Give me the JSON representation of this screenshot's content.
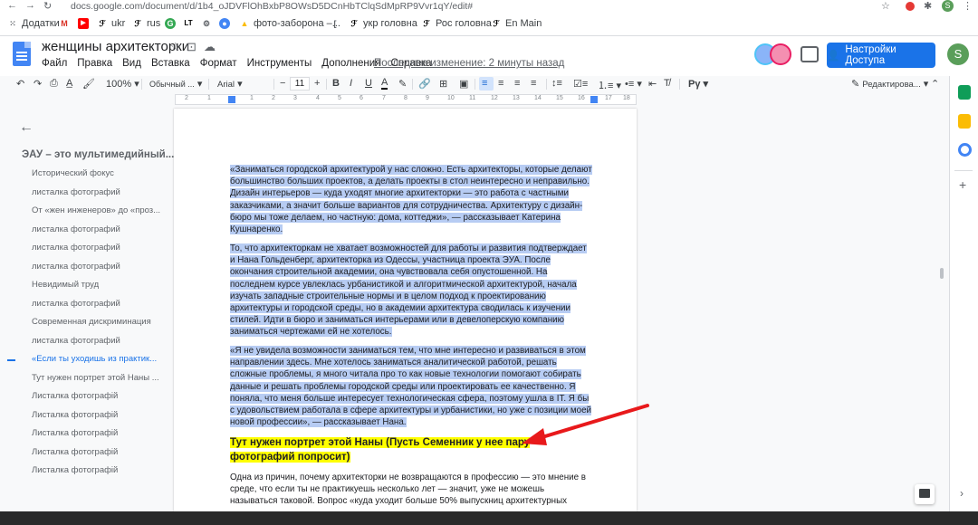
{
  "browser": {
    "url": "docs.google.com/document/d/1b4_oJDVFlOhBxbP8OWsD5DCnHbTClqSdMpRP9Vvr1qY/edit#",
    "bookmarks": [
      "Додатки",
      "ukr",
      "rus",
      "фото-заборона –...",
      "укр головна",
      "Рос головна",
      "En Main"
    ]
  },
  "doc": {
    "title": "женщины архитекторки",
    "menus": [
      "Файл",
      "Правка",
      "Вид",
      "Вставка",
      "Формат",
      "Инструменты",
      "Дополнения",
      "Справка"
    ],
    "last_edit": "Последнее изменение: 2 минуты назад",
    "share_label": "Настройки Доступа",
    "user_initial": "S"
  },
  "toolbar": {
    "zoom": "100%",
    "style": "Обычный ...",
    "font": "Arial",
    "size": "11",
    "mode": "Редактирова..."
  },
  "ruler": [
    "2",
    "1",
    "1",
    "2",
    "3",
    "4",
    "5",
    "6",
    "7",
    "8",
    "9",
    "10",
    "11",
    "12",
    "13",
    "14",
    "15",
    "16",
    "17",
    "18"
  ],
  "outline": {
    "title": "ЭАУ – это мультимедийный...",
    "items": [
      "Исторический фокус",
      "листалка фотографий",
      "От «жен инженеров» до «проз...",
      "листалка фотографий",
      "листалка фотографий",
      "листалка фотографий",
      "Невидимый труд",
      "листалка фотографий",
      "Современная дискриминация",
      "листалка фотографий",
      "«Если ты уходишь из практик...",
      "Тут нужен портрет этой Наны ...",
      "Листалка фотографій",
      "Листалка фотографій",
      "Листалка фотографій",
      "Листалка фотографій",
      "Листалка фотографій"
    ],
    "active_index": 10
  },
  "body": {
    "p1": "«Заниматься городской архитектурой у нас сложно. Есть архитекторы, которые делают большинство больших проектов, а  делать проекты в стол неинтересно и неправильно. Дизайн интерьеров — куда уходят многие архитекторки — это работа с частными заказчиками, а значит больше вариантов для сотрудничества. Архитектуру с дизайн-бюро мы тоже делаем, но частную: дома, коттеджи», — рассказывает Катерина Кушнаренко.",
    "p2": "То, что архитекторкам не хватает возможностей для работы и развития подтверждает и Нана Гольденберг, архитекторка из Одессы, участница проекта ЭУА. После окончания строительной академии, она чувствовала себя опустошенной. На последнем курсе увлеклась урбанистикой и алгоритмической архитектурой, начала изучать западные строительные нормы и в целом подход к проектированию архитектуры и городской среды, но в академии архитектура сводилась к изучении стилей. Идти в бюро и заниматься интерьерами или в девелоперскую компанию заниматься чертежами ей не хотелось.",
    "p3": "«Я не увидела возможности заниматься тем, что мне интересно и развиваться в этом направлении здесь. Мне хотелось заниматься аналитической работой, решать сложные проблемы, я много читала про то как новые технологии помогают собирать данные и решать проблемы городской среды или проектировать ее качественно. Я поняла, что меня больше интересует технологическая сфера, поэтому ушла в IT. Я бы с удовольствием работала в сфере архитектуры и урбанистики, но уже с позиции моей новой профессии», — рассказывает Нана.",
    "heading": "Тут нужен портрет этой Наны (Пусть Семенник у нее пару фотографий попросит)",
    "p4": "Одна из причин, почему архитекторки не возвращаются в профессию — это мнение в среде, что если ты не практикуешь несколько лет — значит, уже не можешь называться таковой. Вопрос «куда уходит больше 50% выпускниц архитектурных"
  }
}
